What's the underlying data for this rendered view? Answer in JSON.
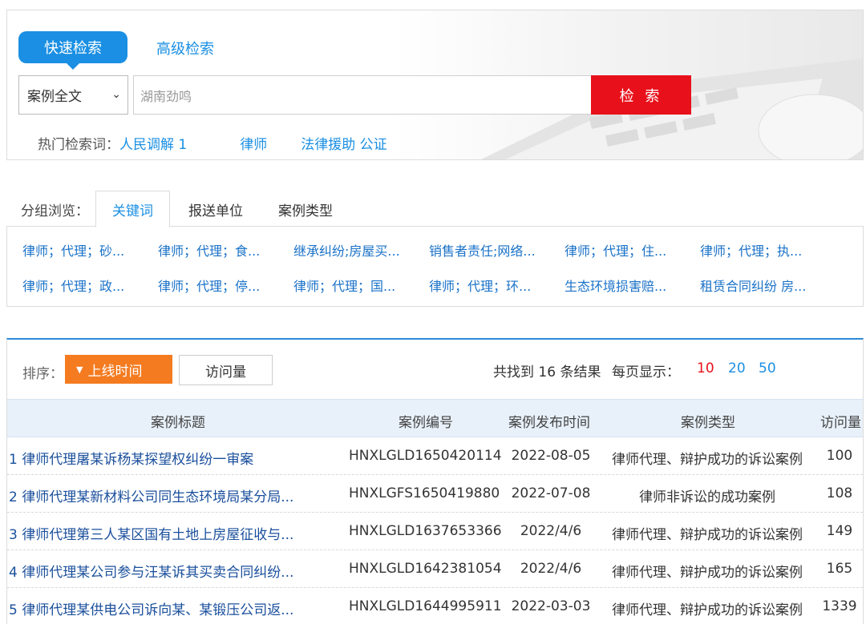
{
  "search": {
    "tab_fast": "快速检索",
    "tab_advanced": "高级检索",
    "scope": "案例全文",
    "query": "湖南劲鸣",
    "button": "检 索",
    "hot_label": "热门检索词：",
    "hot_terms": [
      "人民调解 1",
      "律师",
      "法律援助 公证"
    ]
  },
  "group": {
    "label": "分组浏览：",
    "tabs": [
      "关键词",
      "报送单位",
      "案例类型"
    ],
    "keywords_row1": [
      "律师；代理；砂...",
      "律师；代理；食...",
      "继承纠纷;房屋买...",
      "销售者责任;网络...",
      "律师；代理；住...",
      "律师；代理；执..."
    ],
    "keywords_row2": [
      "律师；代理；政...",
      "律师；代理；停...",
      "律师；代理；国...",
      "律师；代理；环...",
      "生态环境损害赔...",
      "租赁合同纠纷 房..."
    ]
  },
  "results": {
    "sort_label": "排序：",
    "sort_time": "上线时间",
    "sort_visits": "访问量",
    "count_text": "共找到 16 条结果",
    "per_page_label": "每页显示：",
    "per_page_options": [
      "10",
      "20",
      "50"
    ],
    "columns": [
      "案例标题",
      "案例编号",
      "案例发布时间",
      "案例类型",
      "访问量"
    ],
    "rows": [
      {
        "title": "1 律师代理屠某诉杨某探望权纠纷一审案",
        "code": "HNXLGLD1650420114",
        "date": "2022-08-05",
        "type": "律师代理、辩护成功的诉讼案例",
        "views": "100"
      },
      {
        "title": "2 律师代理某新材料公司同生态环境局某分局...",
        "code": "HNXLGFS1650419880",
        "date": "2022-07-08",
        "type": "律师非诉讼的成功案例",
        "views": "108"
      },
      {
        "title": "3 律师代理第三人某区国有土地上房屋征收与...",
        "code": "HNXLGLD1637653366",
        "date": "2022/4/6",
        "type": "律师代理、辩护成功的诉讼案例",
        "views": "149"
      },
      {
        "title": "4 律师代理某公司参与汪某诉其买卖合同纠纷...",
        "code": "HNXLGLD1642381054",
        "date": "2022/4/6",
        "type": "律师代理、辩护成功的诉讼案例",
        "views": "165"
      },
      {
        "title": "5 律师代理某供电公司诉向某、某锻压公司返...",
        "code": "HNXLGLD1644995911",
        "date": "2022-03-03",
        "type": "律师代理、辩护成功的诉讼案例",
        "views": "1339"
      }
    ]
  }
}
